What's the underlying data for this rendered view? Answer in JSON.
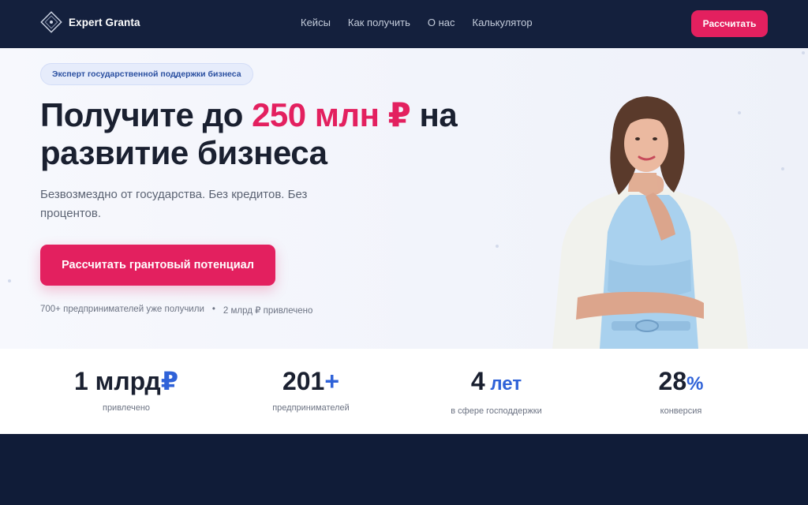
{
  "header": {
    "brand": "Expert Granta",
    "nav": [
      "Кейсы",
      "Как получить",
      "О нас",
      "Калькулятор"
    ],
    "cta_label": "Рассчитать"
  },
  "hero": {
    "badge": "Эксперт государственной поддержки бизнеса",
    "headline_part1": "Получите до ",
    "headline_accent": "250 млн ₽",
    "headline_part2": " на развитие бизнеса",
    "subtitle": "Безвозмездно от государства. Без кредитов. Без процентов.",
    "cta_label": "Рассчитать грантовый потенциал",
    "proof_1": "700+ предпринимателей уже получили",
    "proof_separator": "•",
    "proof_2": "2 млрд ₽ привлечено"
  },
  "stats": [
    {
      "value": "1 млрд",
      "suffix": "₽",
      "label": "привлечено"
    },
    {
      "value": "201",
      "suffix": "+",
      "label": "предпринимателей"
    },
    {
      "value": "4",
      "suffix": " лет",
      "label": "в сфере господдержки"
    },
    {
      "value": "28",
      "suffix": "%",
      "label": "конверсия"
    }
  ],
  "colors": {
    "accent": "#e3205f",
    "secondary": "#2f62d8",
    "dark": "#14203d"
  }
}
